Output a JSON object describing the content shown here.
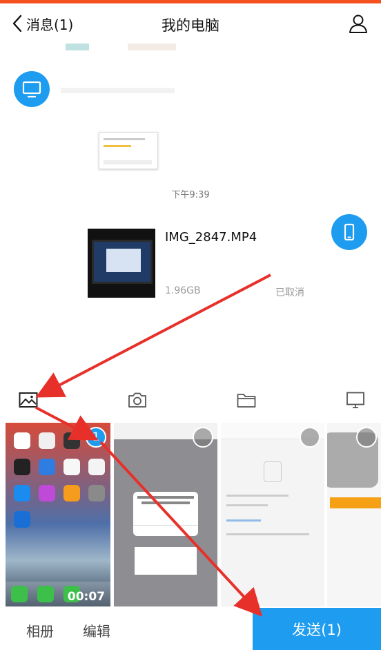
{
  "header": {
    "back_label": "消息(1)",
    "title": "我的电脑"
  },
  "chat": {
    "time": "下午9:39",
    "file": {
      "name": "IMG_2847.MP4",
      "size": "1.96GB",
      "status": "已取消"
    }
  },
  "toolbar": {
    "items": [
      "image-icon",
      "camera-icon",
      "folder-icon",
      "computer-icon"
    ]
  },
  "gallery": {
    "selected_badge": "1",
    "video_duration": "00:07"
  },
  "bottom": {
    "album_label": "相册",
    "edit_label": "编辑",
    "send_label": "发送(1)"
  },
  "colors": {
    "accent": "#1e9cf0",
    "top_strip": "#f4511e",
    "annotation_arrow": "#e8302a"
  }
}
